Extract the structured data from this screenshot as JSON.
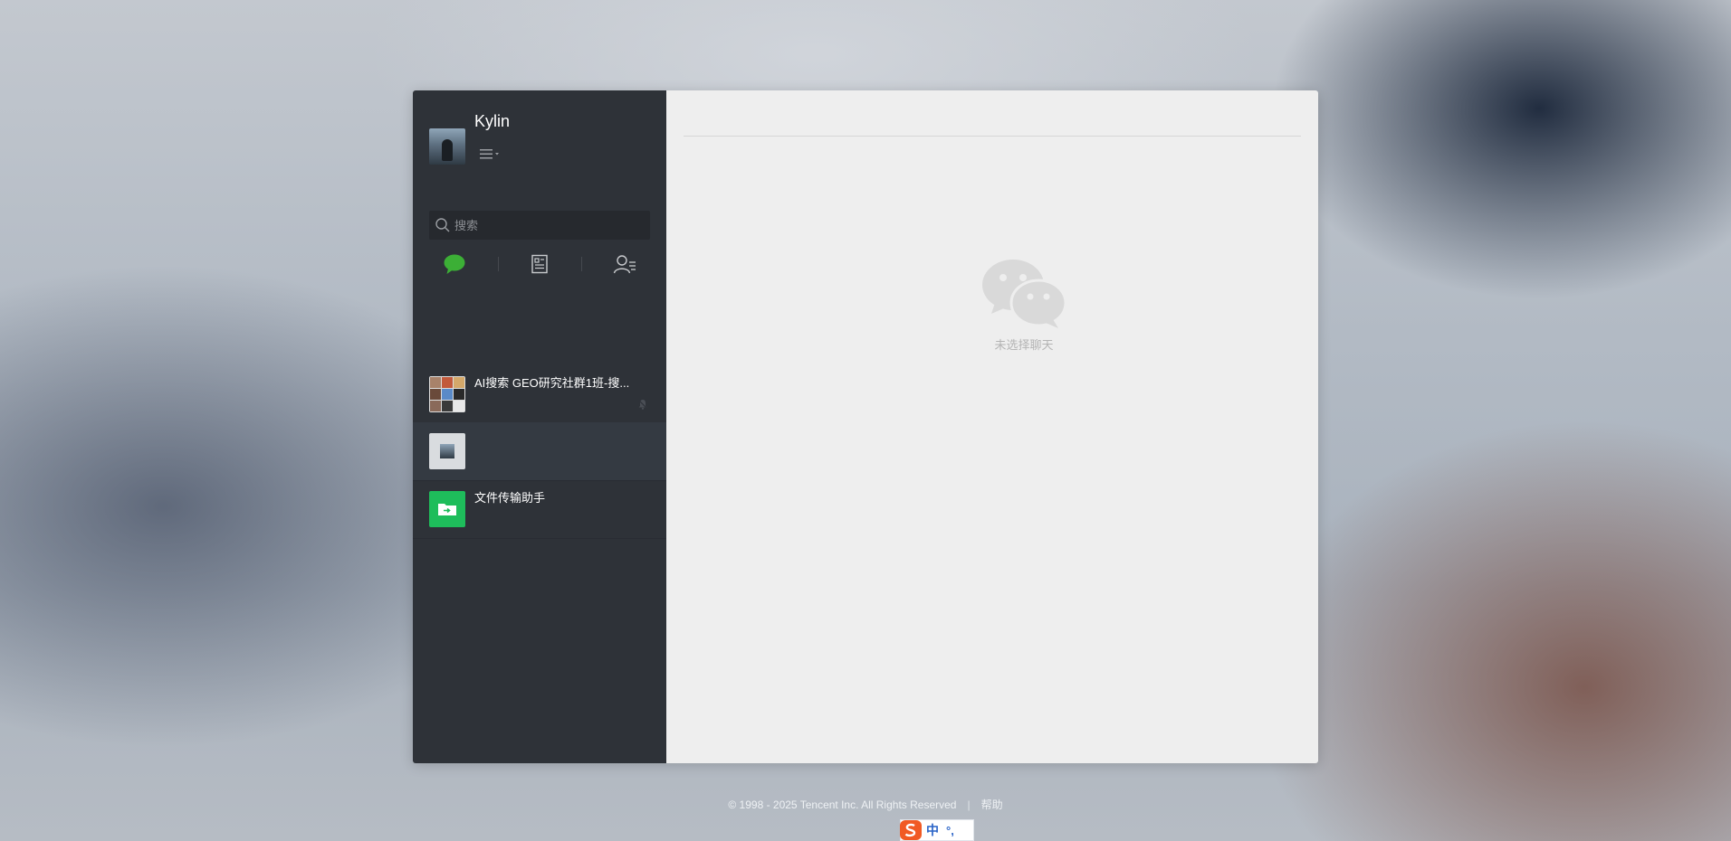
{
  "profile": {
    "nickname": "Kylin",
    "menu_icon": "menu-icon"
  },
  "search": {
    "placeholder": "搜索",
    "icon": "search-icon"
  },
  "tabs": [
    {
      "name": "chat",
      "icon": "chat-bubble-icon",
      "active": true,
      "color": "#3caf36"
    },
    {
      "name": "articles",
      "icon": "document-icon",
      "active": false
    },
    {
      "name": "contacts",
      "icon": "contacts-icon",
      "active": false
    }
  ],
  "conversations": [
    {
      "name": "AI搜索 GEO研究社群1班-搜...",
      "avatar": "group-grid-avatar",
      "muted": true,
      "active": false
    },
    {
      "name": "",
      "avatar": "user-avatar",
      "muted": false,
      "active": true
    },
    {
      "name": "文件传输助手",
      "avatar": "file-transfer-icon",
      "muted": false,
      "active": false,
      "color": "#1ebd5b"
    }
  ],
  "main": {
    "empty_icon": "wechat-logo-icon",
    "empty_text": "未选择聊天"
  },
  "footer": {
    "copyright": "© 1998 - 2025 Tencent Inc. All Rights Reserved",
    "separator": "|",
    "help_label": "帮助"
  },
  "ime": {
    "logo": "sogou-logo-icon",
    "lang": "中",
    "punct": "°,"
  },
  "colors": {
    "sidebar_bg": "#2e3238",
    "main_bg": "#eeeeee",
    "accent_green": "#3caf36"
  }
}
